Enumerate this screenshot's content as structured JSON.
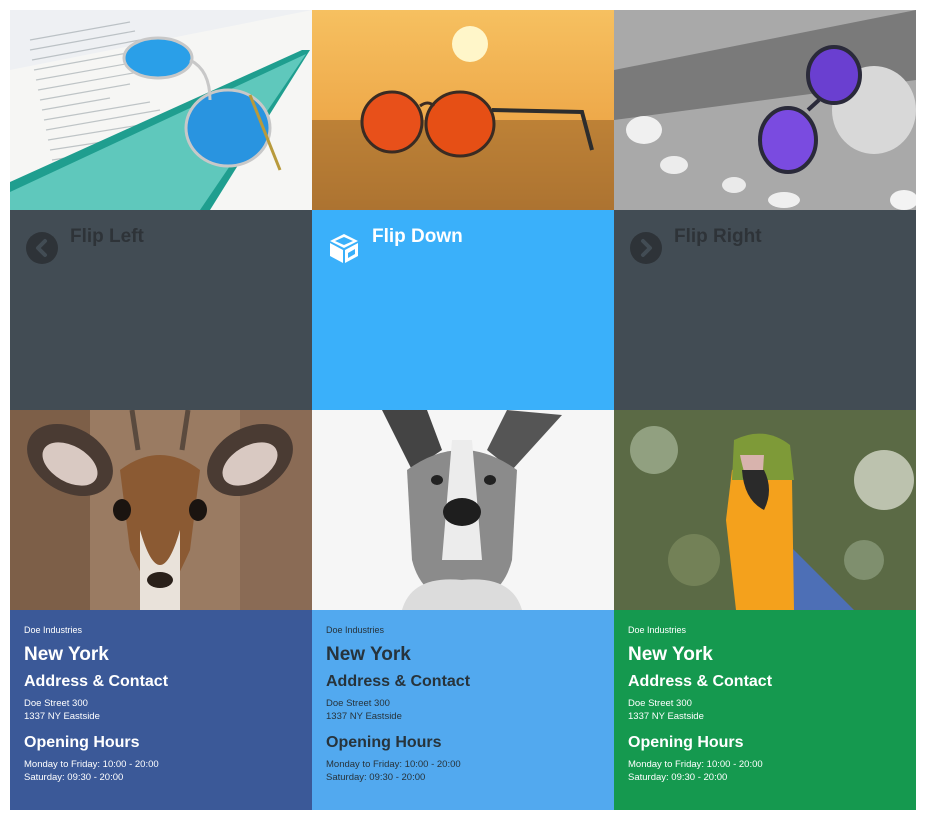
{
  "flip_tiles": [
    {
      "label": "Flip Left",
      "icon": "chevron-left-circle-icon",
      "bg": "#424c54"
    },
    {
      "label": "Flip Down",
      "icon": "cube-icon",
      "bg": "#3ab0fa"
    },
    {
      "label": "Flip Right",
      "icon": "chevron-right-circle-icon",
      "bg": "#424c54"
    }
  ],
  "info_cards": [
    {
      "bg": "#3b5998",
      "company": "Doe Industries",
      "city": "New York",
      "address_heading": "Address & Contact",
      "address_lines": [
        "Doe Street 300",
        "1337 NY Eastside"
      ],
      "hours_heading": "Opening Hours",
      "hours_lines": [
        "Monday to Friday: 10:00 - 20:00",
        "Saturday: 09:30 - 20:00"
      ]
    },
    {
      "bg": "#52a9ef",
      "company": "Doe Industries",
      "city": "New York",
      "address_heading": "Address & Contact",
      "address_lines": [
        "Doe Street 300",
        "1337 NY Eastside"
      ],
      "hours_heading": "Opening Hours",
      "hours_lines": [
        "Monday to Friday: 10:00 - 20:00",
        "Saturday: 09:30 - 20:00"
      ]
    },
    {
      "bg": "#15994f",
      "company": "Doe Industries",
      "city": "New York",
      "address_heading": "Address & Contact",
      "address_lines": [
        "Doe Street 300",
        "1337 NY Eastside"
      ],
      "hours_heading": "Opening Hours",
      "hours_lines": [
        "Monday to Friday: 10:00 - 20:00",
        "Saturday: 09:30 - 20:00"
      ]
    }
  ]
}
